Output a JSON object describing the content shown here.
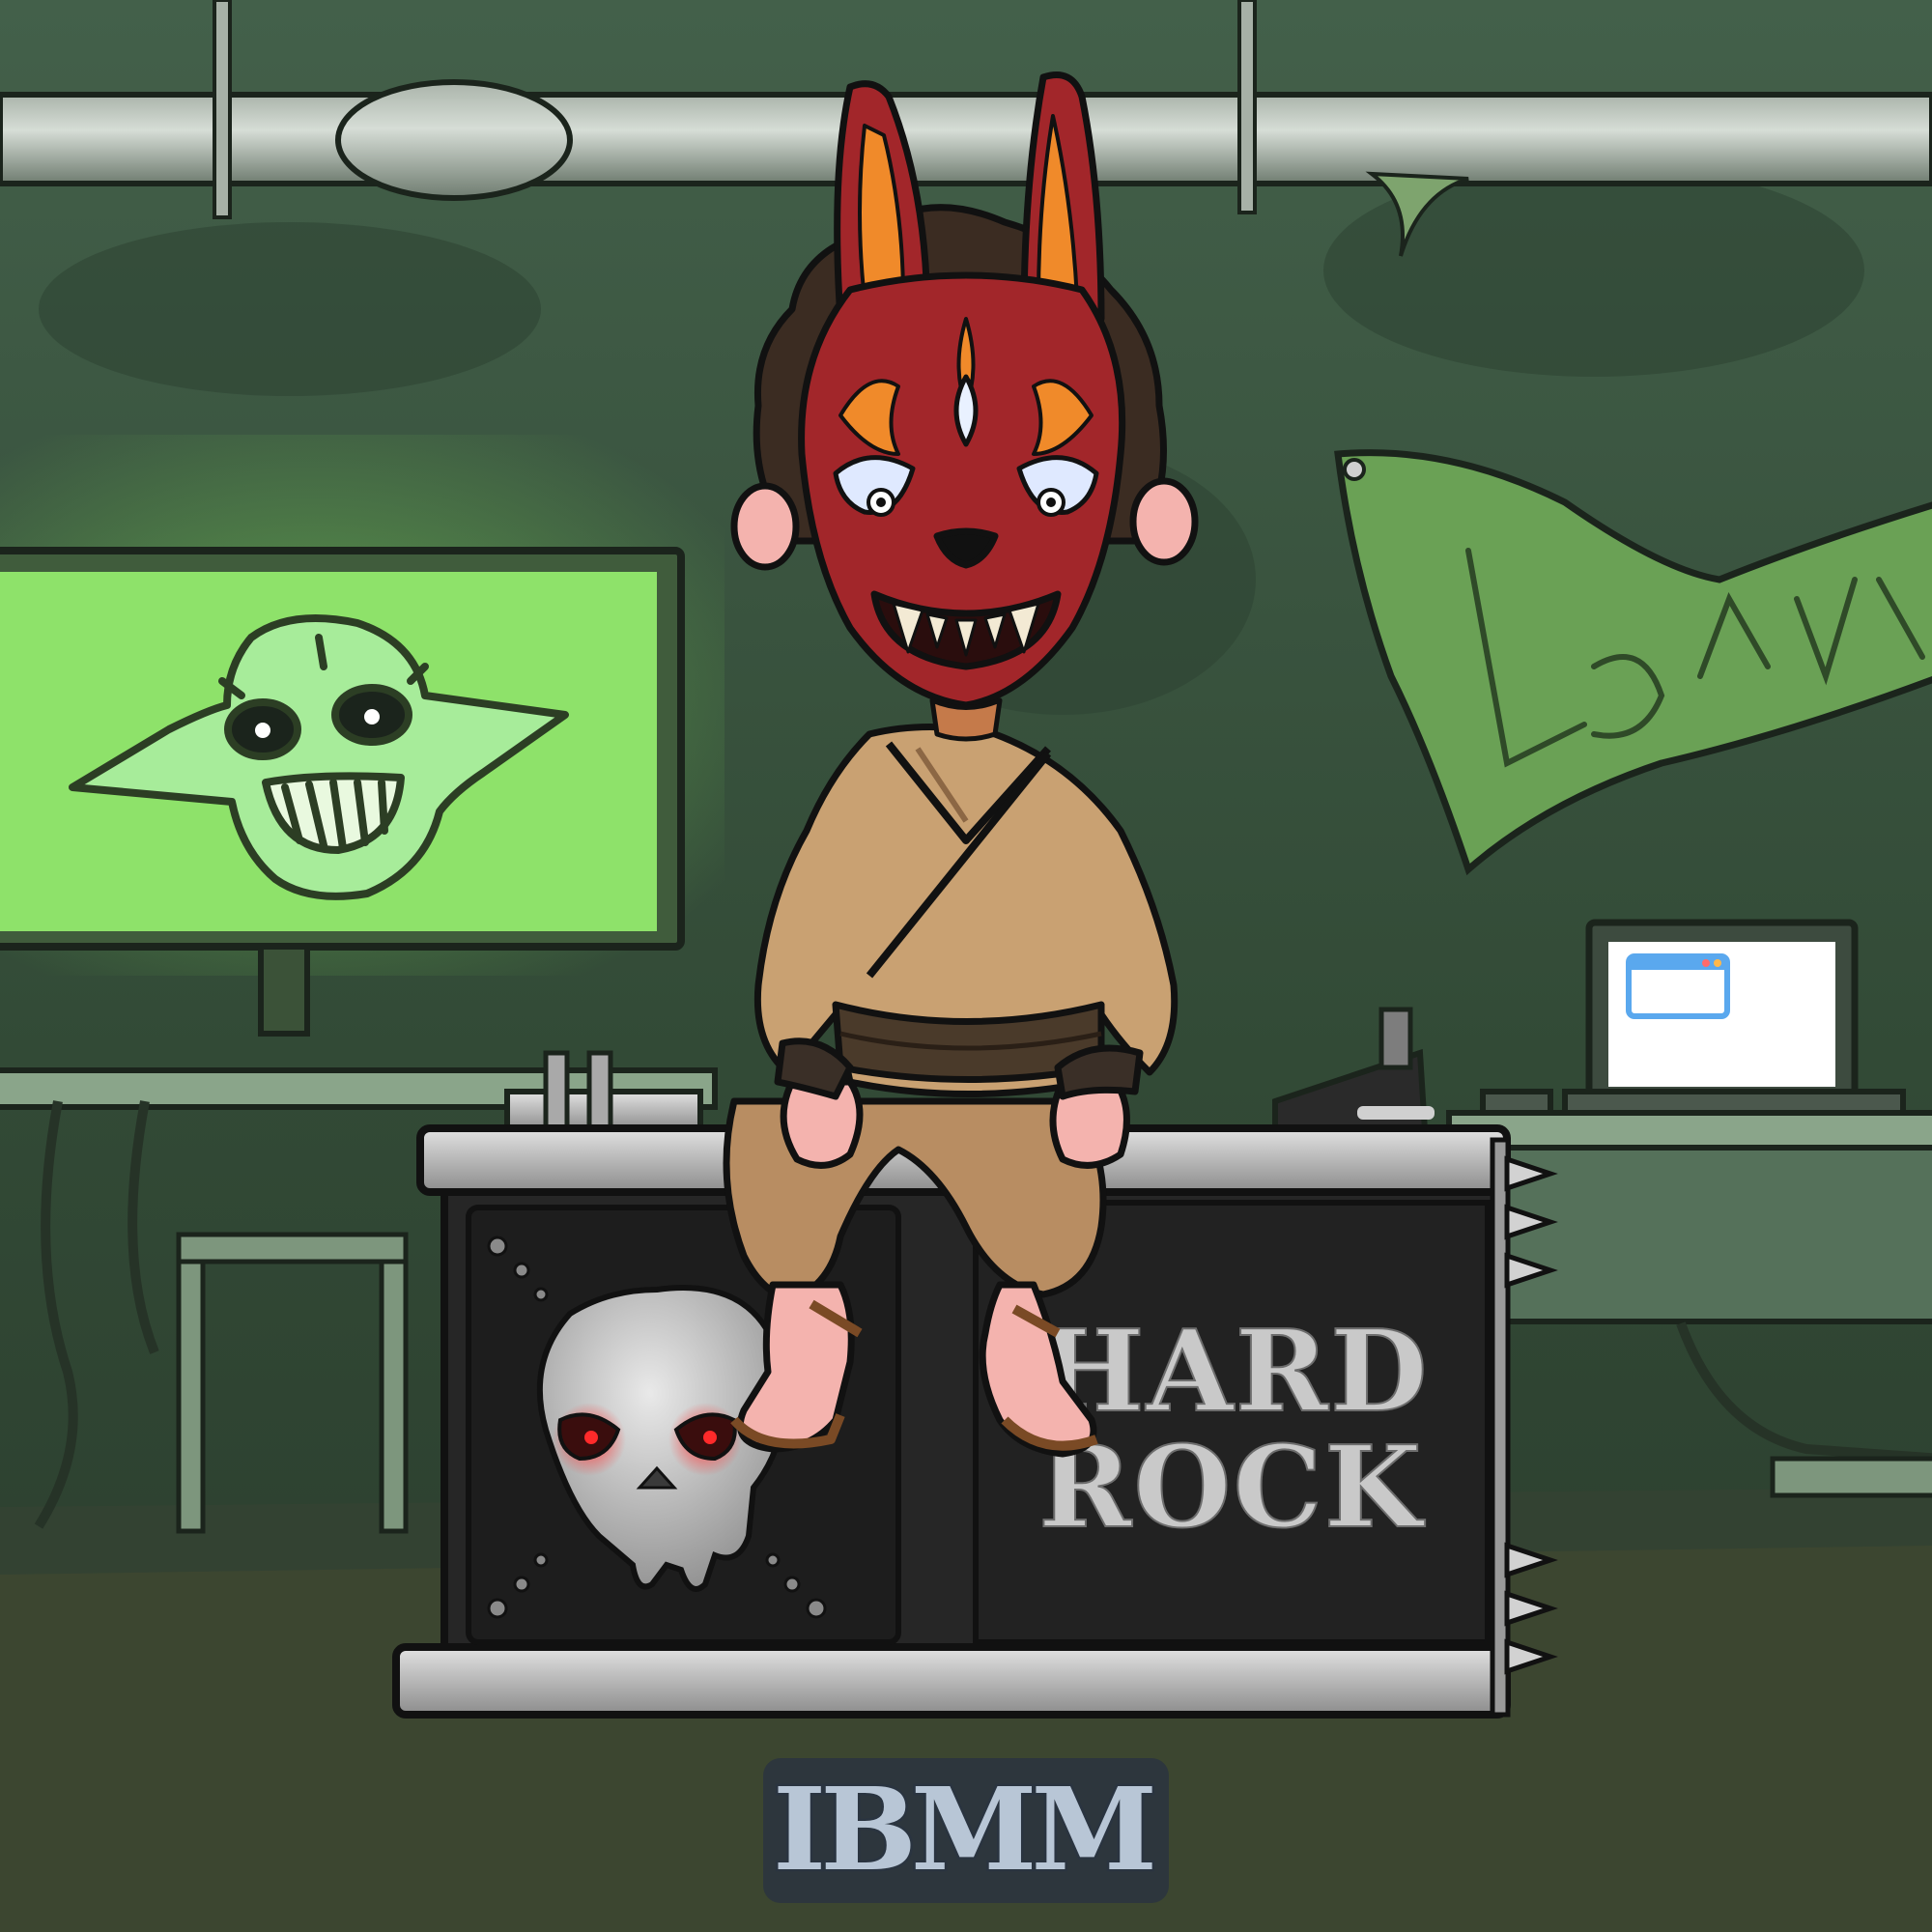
{
  "scene": {
    "crate_text_line1": "HARD",
    "crate_text_line2": "ROCK",
    "logo_text": "IBMM"
  },
  "palette": {
    "wall": "#3a523a",
    "wall_dark": "#2a3d2b",
    "floor": "#3c4630",
    "screen_glow": "#8ee26a",
    "banner": "#6aa155",
    "mask_red": "#a2262a",
    "mask_orange": "#f08a2a",
    "robe": "#c9a172",
    "crate_metal": "#b9b9b9",
    "crate_panel": "#262626",
    "skull_eye": "#ff2a2a",
    "laptop_window": "#5aa8ee"
  },
  "icons": [
    "goblin-drawing-icon",
    "skull-icon",
    "window-icon"
  ]
}
